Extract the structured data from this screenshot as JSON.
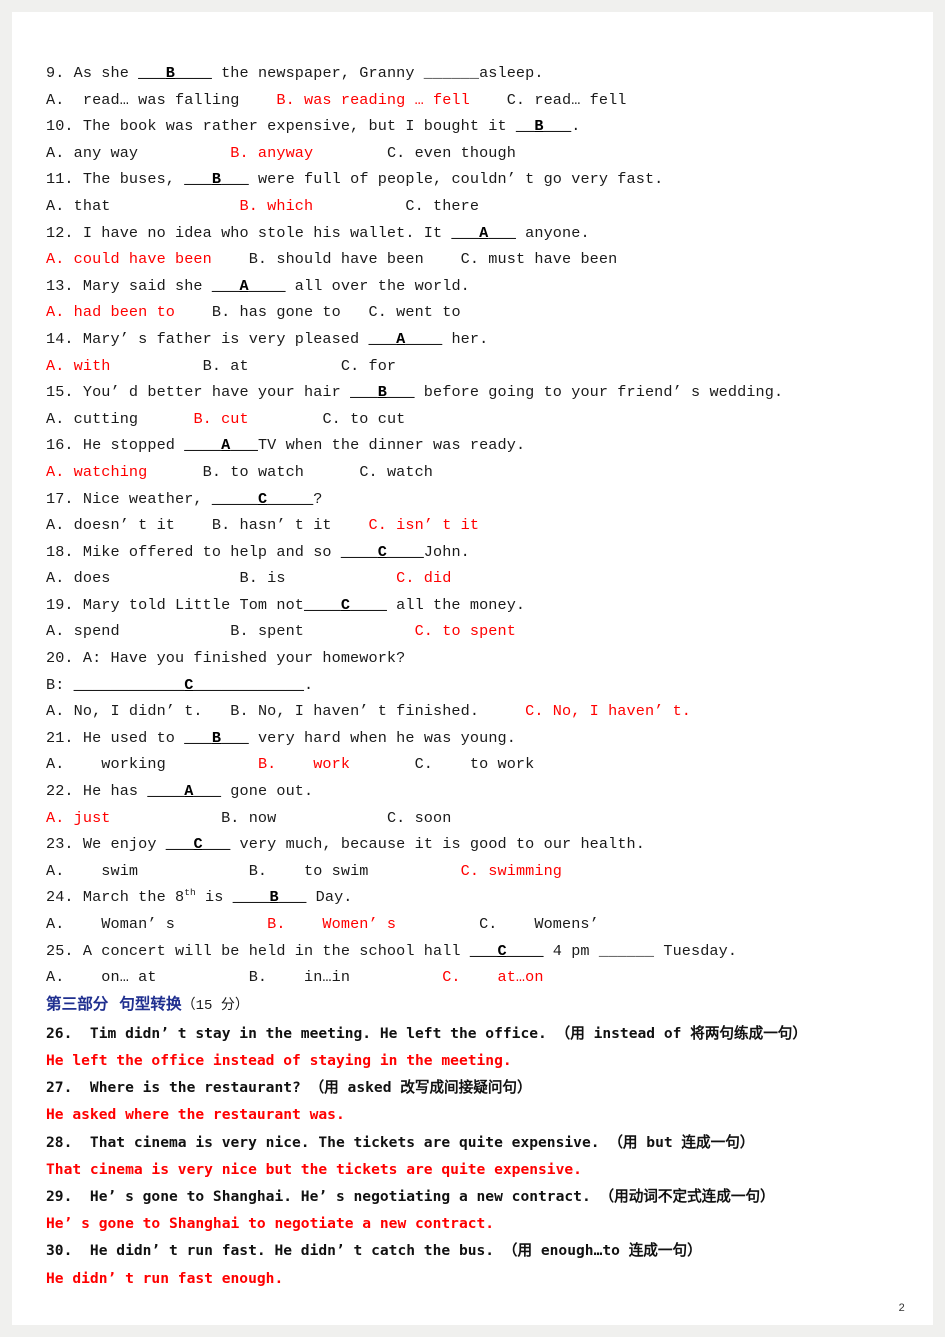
{
  "page": {
    "page_number": "2",
    "background_color": "#f0f0ee",
    "paper_color": "#ffffff",
    "answer_color": "#ff0000",
    "heading_color": "#1f2f8f"
  },
  "multiple_choice": [
    {
      "question": "9. As she ",
      "q_blank_pre": "___",
      "q_answer": "B",
      "q_blank_post": "____",
      "q_tail": " the newspaper, Granny ______asleep.",
      "options_line": [
        {
          "text": "A.  read… was falling",
          "color": "black"
        },
        {
          "text": "B. was reading … fell",
          "color": "red"
        },
        {
          "text": "C. read… fell",
          "color": "black"
        }
      ]
    },
    {
      "question": "10. The book was rather expensive, but I bought it ",
      "q_blank_pre": "__",
      "q_answer": "B",
      "q_blank_post": "___",
      "q_tail": ".",
      "options_line": [
        {
          "text": "A. any way",
          "color": "black"
        },
        {
          "text": "B. anyway",
          "color": "red"
        },
        {
          "text": "C. even though",
          "color": "black"
        }
      ]
    },
    {
      "question": "11. The buses, ",
      "q_blank_pre": "___",
      "q_answer": "B",
      "q_blank_post": "___",
      "q_tail": " were full of people, couldn’ t go very fast.",
      "options_line": [
        {
          "text": "A. that",
          "color": "black"
        },
        {
          "text": "B. which",
          "color": "red"
        },
        {
          "text": "C. there",
          "color": "black"
        }
      ]
    },
    {
      "question": "12. I have no idea who stole his wallet. It ",
      "q_blank_pre": "___",
      "q_answer": "A",
      "q_blank_post": "___",
      "q_tail": " anyone.",
      "options_line": [
        {
          "text": "A. could have been",
          "color": "red"
        },
        {
          "text": "B. should have been",
          "color": "black"
        },
        {
          "text": "C. must have been",
          "color": "black"
        }
      ]
    },
    {
      "question": "13. Mary said she ",
      "q_blank_pre": "___",
      "q_answer": "A",
      "q_blank_post": "____",
      "q_tail": " all over the world.",
      "options_line": [
        {
          "text": "A. had been to",
          "color": "red"
        },
        {
          "text": "B. has gone to",
          "color": "black"
        },
        {
          "text": "C. went to",
          "color": "black"
        }
      ]
    },
    {
      "question": "14. Mary’ s father is very pleased ",
      "q_blank_pre": "___",
      "q_answer": "A",
      "q_blank_post": "____",
      "q_tail": " her.",
      "options_line": [
        {
          "text": "A. with",
          "color": "red"
        },
        {
          "text": "B. at",
          "color": "black"
        },
        {
          "text": "C. for",
          "color": "black"
        }
      ]
    },
    {
      "question": "15. You’ d better have your hair ",
      "q_blank_pre": "___",
      "q_answer": "B",
      "q_blank_post": "___",
      "q_tail": " before going to your friend’ s wedding.",
      "options_line": [
        {
          "text": "A. cutting",
          "color": "black"
        },
        {
          "text": "B. cut",
          "color": "red"
        },
        {
          "text": "C. to cut",
          "color": "black"
        }
      ]
    },
    {
      "question": "16. He stopped ",
      "q_blank_pre": "____",
      "q_answer": "A",
      "q_blank_post": "___",
      "q_tail": "TV when the dinner was ready.",
      "options_line": [
        {
          "text": "A. watching",
          "color": "red"
        },
        {
          "text": "B. to watch",
          "color": "black"
        },
        {
          "text": "C. watch",
          "color": "black"
        }
      ]
    },
    {
      "question": "17. Nice weather, ",
      "q_blank_pre": "_____",
      "q_answer": "C",
      "q_blank_post": "_____",
      "q_tail": "?",
      "options_line": [
        {
          "text": "A. doesn’ t it",
          "color": "black"
        },
        {
          "text": "B. hasn’ t it",
          "color": "black"
        },
        {
          "text": "C. isn’ t it",
          "color": "red"
        }
      ]
    },
    {
      "question": "18. Mike offered to help and so ",
      "q_blank_pre": "____",
      "q_answer": "C",
      "q_blank_post": "____",
      "q_tail": "John.",
      "options_line": [
        {
          "text": "A. does",
          "color": "black"
        },
        {
          "text": "B. is",
          "color": "black"
        },
        {
          "text": "C. did",
          "color": "red"
        }
      ]
    },
    {
      "question": "19. Mary told Little Tom not",
      "q_blank_pre": "____",
      "q_answer": "C",
      "q_blank_post": "____",
      "q_tail": " all the money.",
      "options_line": [
        {
          "text": "A. spend",
          "color": "black"
        },
        {
          "text": "B. spent",
          "color": "black"
        },
        {
          "text": "C. to spent",
          "color": "red"
        }
      ]
    },
    {
      "question": "20. A: Have you finished your homework?",
      "q_blank_pre": "",
      "q_answer": "",
      "q_blank_post": "",
      "q_tail": "",
      "options_line": []
    },
    {
      "question": "B: ",
      "q_blank_pre": "____________",
      "q_answer": "C",
      "q_blank_post": "____________",
      "q_tail": ".",
      "options_line": [
        {
          "text": "A. No, I didn’ t.",
          "color": "black"
        },
        {
          "text": "B. No, I haven’ t finished.",
          "color": "black"
        },
        {
          "text": "C. No, I haven’ t.",
          "color": "red"
        }
      ]
    },
    {
      "question": "21. He used to ",
      "q_blank_pre": "___",
      "q_answer": "B",
      "q_blank_post": "___",
      "q_tail": " very hard when he was young.",
      "options_line": [
        {
          "text": "A.    working",
          "color": "black"
        },
        {
          "text": "B.    work",
          "color": "red"
        },
        {
          "text": "C.    to work",
          "color": "black"
        }
      ]
    },
    {
      "question": "22. He has ",
      "q_blank_pre": "____",
      "q_answer": "A",
      "q_blank_post": "___",
      "q_tail": " gone out.",
      "options_line": [
        {
          "text": "A. just",
          "color": "red"
        },
        {
          "text": "B. now",
          "color": "black"
        },
        {
          "text": "C. soon",
          "color": "black"
        }
      ]
    },
    {
      "question": "23. We enjoy ",
      "q_blank_pre": "___",
      "q_answer": "C",
      "q_blank_post": "___",
      "q_tail": " very much, because it is good to our health.",
      "options_line": [
        {
          "text": "A.    swim",
          "color": "black"
        },
        {
          "text": "B.    to swim",
          "color": "black"
        },
        {
          "text": "C. swimming",
          "color": "red"
        }
      ]
    },
    {
      "question": "24. March the 8th is ",
      "q_blank_pre": "____",
      "q_answer": "B",
      "q_blank_post": "___",
      "q_tail": " Day.",
      "options_line": [
        {
          "text": "A.    Woman’ s",
          "color": "black"
        },
        {
          "text": "B.    Women’ s",
          "color": "red"
        },
        {
          "text": "C.    Womens’",
          "color": "black"
        }
      ]
    },
    {
      "question": "25. A concert will be held in the school hall ",
      "q_blank_pre": "___",
      "q_answer": "C",
      "q_blank_post": "____",
      "q_tail": " 4 pm ______ Tuesday.",
      "options_line": [
        {
          "text": "A.    on… at",
          "color": "black"
        },
        {
          "text": "B.    in…in",
          "color": "black"
        },
        {
          "text": "C.    at…on",
          "color": "red"
        }
      ]
    }
  ],
  "section_three": {
    "heading": "第三部分  句型转换",
    "points": "（15 分）",
    "items": [
      {
        "prompt": "26.  Tim didn’ t stay in the meeting. He left the office. （用 instead of 将两句练成一句）",
        "answer": "He left the office instead of staying in the meeting."
      },
      {
        "prompt": "27.  Where is the restaurant? （用 asked 改写成间接疑问句）",
        "answer": "He asked where the restaurant was."
      },
      {
        "prompt": "28.  That cinema is very nice. The tickets are quite expensive. （用 but 连成一句）",
        "answer": "That cinema is very nice but the tickets are quite expensive."
      },
      {
        "prompt": "29.  He’ s gone to Shanghai. He’ s negotiating a new contract. （用动词不定式连成一句）",
        "answer": "He’ s gone to Shanghai to negotiate a new contract."
      },
      {
        "prompt": "30.  He didn’ t run fast. He didn’ t catch the bus. （用 enough…to 连成一句）",
        "answer": "He didn’ t run fast enough."
      }
    ]
  }
}
